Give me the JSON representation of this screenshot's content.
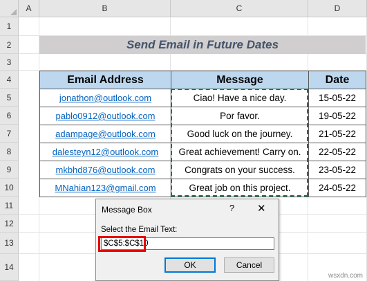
{
  "columns": [
    "A",
    "B",
    "C",
    "D"
  ],
  "rows": [
    "1",
    "2",
    "3",
    "4",
    "5",
    "6",
    "7",
    "8",
    "9",
    "10",
    "11",
    "12",
    "13",
    "14"
  ],
  "title": "Send Email in Future Dates",
  "table": {
    "headers": [
      "Email Address",
      "Message",
      "Date"
    ],
    "rows": [
      {
        "email": "jonathon@outlook.com",
        "message": "Ciao! Have a nice day.",
        "date": "15-05-22"
      },
      {
        "email": "pablo0912@outlook.com",
        "message": "Por favor.",
        "date": "19-05-22"
      },
      {
        "email": "adampage@outlook.com",
        "message": "Good luck on the journey.",
        "date": "21-05-22"
      },
      {
        "email": "dalesteyn12@outlook.com",
        "message": "Great achievement! Carry on.",
        "date": "22-05-22"
      },
      {
        "email": "mkbhd876@outlook.com",
        "message": "Congrats on your success.",
        "date": "23-05-22"
      },
      {
        "email": "MNahian123@gmail.com",
        "message": "Great job on this project.",
        "date": "24-05-22"
      }
    ]
  },
  "dialog": {
    "title": "Message Box",
    "help": "?",
    "close": "✕",
    "prompt": "Select the Email Text:",
    "input_value": "$C$5:$C$10",
    "ok_label": "OK",
    "cancel_label": "Cancel"
  },
  "watermark": "wsxdn.com",
  "colors": {
    "header_fill": "#bdd7ee",
    "title_fill": "#d0cece",
    "title_text": "#44546a",
    "link": "#0563c1",
    "marquee": "#217346",
    "highlight": "#e60000"
  }
}
